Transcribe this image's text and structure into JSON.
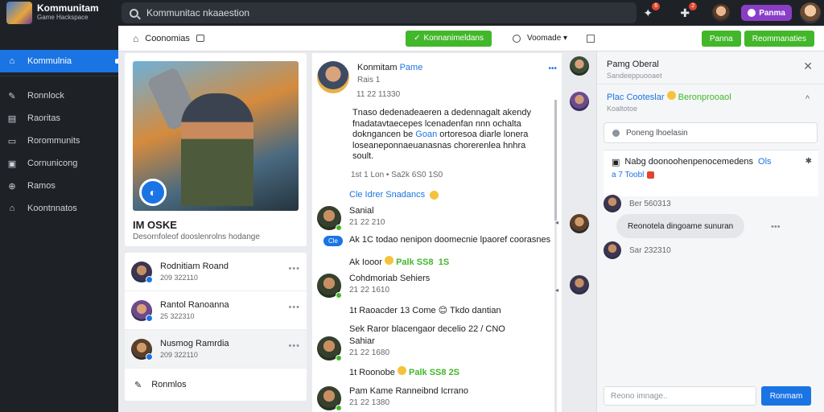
{
  "app": {
    "title": "Kommunitam",
    "subtitle": "Game Hackspace"
  },
  "search": {
    "placeholder": "Kommunitac nkaaestion"
  },
  "topbar": {
    "badge_1": "6",
    "badge_2": "2",
    "pill_label": "Panma"
  },
  "sidebar": {
    "items": [
      {
        "label": "Kommulnia",
        "icon": "home-icon"
      },
      {
        "label": "Ronnlock",
        "icon": "wrench-icon"
      },
      {
        "label": "Raoritas",
        "icon": "document-icon"
      },
      {
        "label": "Rorommunits",
        "icon": "chat-icon"
      },
      {
        "label": "Cornunicong",
        "icon": "box-icon"
      },
      {
        "label": "Ramos",
        "icon": "plus-circle-icon"
      },
      {
        "label": "Koontnnatos",
        "icon": "house-icon"
      }
    ]
  },
  "header": {
    "title": "Coonomias",
    "green_button": "Konnanimeldans",
    "dropdown": "Voomade",
    "btn_right_1": "Panna",
    "btn_right_2": "Reommanaties"
  },
  "profile": {
    "name": "IM OSKE",
    "desc": "Desornfoleof dooslenrolns hodange"
  },
  "friends": [
    {
      "name": "Rodnitiam Roand",
      "meta": "209 322110"
    },
    {
      "name": "Rantol Ranoanna",
      "meta": "25 322310"
    },
    {
      "name": "Nusmog Ramrdia",
      "meta": "209 322110"
    }
  ],
  "friends_footer": "Ronmlos",
  "post": {
    "author": "Konmitam",
    "tag": "Pame",
    "time": "Rais 1",
    "date": "11 22 11330",
    "body_1": "Tnaso dedenadeaeren a dedennagalt akendy",
    "body_2": "fnadatavtaecepes lcenadenfan nnn ochalta",
    "body_3_pre": "dokngancen be",
    "body_3_hl": "Goan",
    "body_3_post": "ortoresoa diarle lonera",
    "body_4": "loseaneponnaeuanasnas chorerenlea hnhra",
    "body_5": "soult.",
    "stats": "1st 1 Lon • Sa2k 6S0 1S0",
    "comments_link": "Cle Idrer Snadancs"
  },
  "comments": [
    {
      "name": "Sanial",
      "time": "21 22 210",
      "line": "Ak 1C todao nenipon doomecnie lpaoref coorasnes",
      "reply": "Cle",
      "react_pre": "Ak Iooor",
      "react_green": "Palk",
      "react_post": "SS8  1S"
    },
    {
      "name": "Cohdmoriab Sehiers",
      "time": "21 22 1610",
      "line": "1t Raoacder 13 Come 😊 Tkdo dantian"
    },
    {
      "name": "Sahiar",
      "time": "21 22 1680",
      "pre": "Sek Raror blacengaor decelio 22 / CNO",
      "react_pre": "1t Roonobe",
      "react_green": "Palk",
      "react_post": "SS8 2S"
    },
    {
      "name": "Pam Kame Ranneibnd Icrrano",
      "time": "21 22 1380"
    }
  ],
  "chat": {
    "title": "Pamg Oberal",
    "sub": "Sandeeppuooaet",
    "group_title": "Plac Cooteslar",
    "group_green": "Beronprooaol",
    "group_sub": "Koaltotoe",
    "search_placeholder": "Poneng lhoelasin",
    "notice_title": "Nabg doonoohenpenocemedens",
    "notice_tag": "Ols",
    "notice_line2": "a 7 Toobl",
    "msg_time_1": "Ber 560313",
    "bubble": "Reonotela dingoame sunuran",
    "msg_time_2": "Sar 232310",
    "input_placeholder": "Reono imnage..",
    "send_label": "Ronmam"
  }
}
